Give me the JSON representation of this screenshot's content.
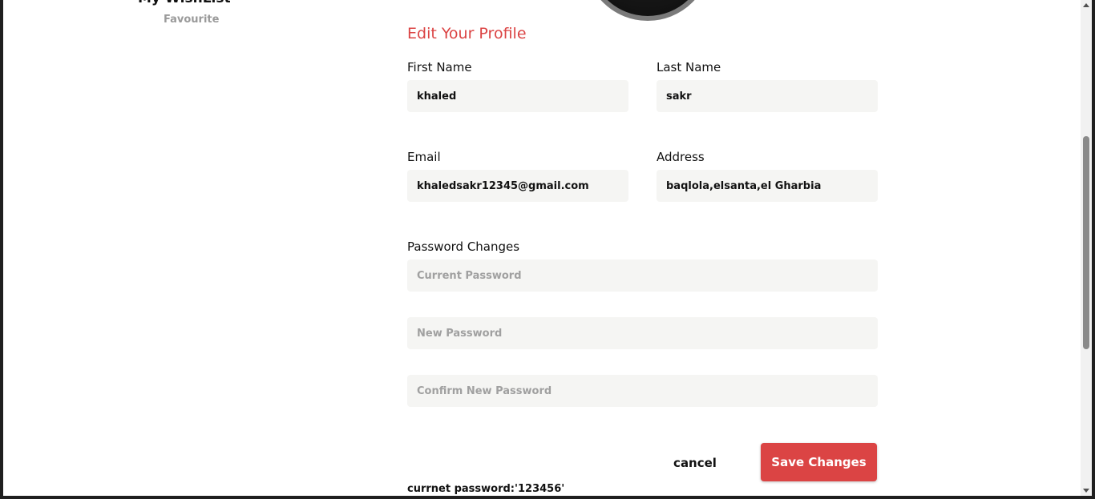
{
  "sidebar": {
    "section_title": "My WishList",
    "items": [
      {
        "label": "Favourite"
      }
    ]
  },
  "profile": {
    "title": "Edit Your Profile",
    "first_name": {
      "label": "First Name",
      "value": "khaled"
    },
    "last_name": {
      "label": "Last Name",
      "value": "sakr"
    },
    "email": {
      "label": "Email",
      "value": "khaledsakr12345@gmail.com"
    },
    "address": {
      "label": "Address",
      "value": "baqlola,elsanta,el Gharbia"
    },
    "password_section_label": "Password Changes",
    "current_password": {
      "placeholder": "Current Password"
    },
    "new_password": {
      "placeholder": "New Password"
    },
    "confirm_password": {
      "placeholder": "Confirm New Password"
    },
    "cancel_label": "cancel",
    "save_label": "Save Changes",
    "hint_text": "currnet password:'123456'"
  },
  "colors": {
    "accent": "#db4444",
    "input_background": "#f5f5f3"
  },
  "icons": {
    "avatar": "avatar-photo"
  }
}
